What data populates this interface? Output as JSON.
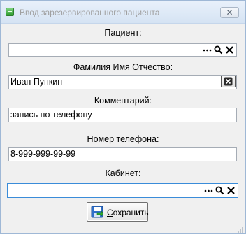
{
  "window": {
    "title": "Ввод зарезервированного пациента",
    "close_glyph": "✕"
  },
  "form": {
    "patient": {
      "label": "Пациент:",
      "value": "",
      "tools": [
        "ellipsis-icon",
        "search-icon",
        "clear-icon"
      ]
    },
    "full_name": {
      "label": "Фамилия Имя Отчество:",
      "value": "Иван Пупкин",
      "tools": [
        "clear-icon"
      ]
    },
    "comment": {
      "label": "Комментарий:",
      "value": "запись по телефону"
    },
    "phone": {
      "label": "Номер телефона:",
      "value": "8-999-999-99-99"
    },
    "cabinet": {
      "label": "Кабинет:",
      "value": "",
      "tools": [
        "ellipsis-icon",
        "search-icon",
        "clear-icon"
      ]
    }
  },
  "save_button": {
    "mnemonic": "С",
    "label_rest": "охранить",
    "icon": "save-icon"
  },
  "colors": {
    "focus_border": "#3a8cd9",
    "title_text": "#a0a0a0",
    "window_bg": "#f0f0f0"
  }
}
